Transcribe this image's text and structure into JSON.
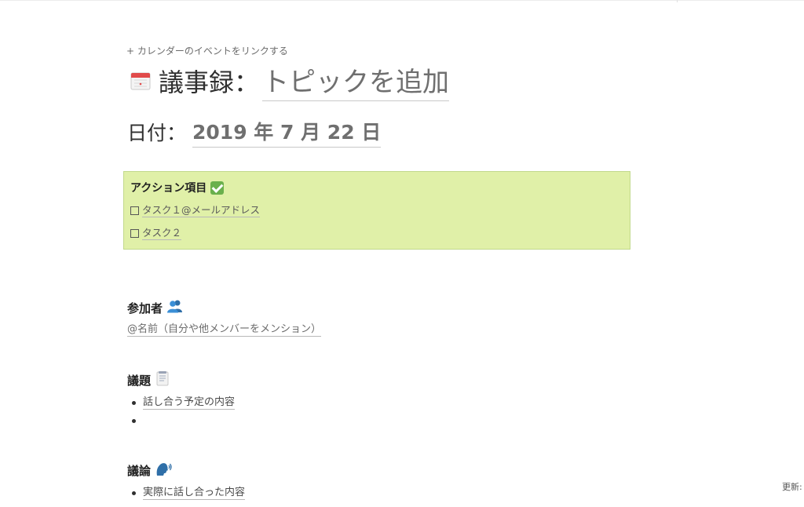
{
  "calendar_link": "+ カレンダーのイベントをリンクする",
  "title": {
    "icon": "calendar-icon",
    "label": "議事録：",
    "topic": "トピックを追加"
  },
  "date": {
    "label": "日付：",
    "value": "2019 年 7 月 22 日"
  },
  "callout": {
    "background": "#e0f0a8",
    "title": "アクション項目",
    "icon": "check-mark-button-icon",
    "todos": [
      {
        "label": "タスク１@メールアドレス",
        "checked": false
      },
      {
        "label": "タスク２",
        "checked": false
      }
    ]
  },
  "participants": {
    "heading": "参加者",
    "icon": "busts-in-silhouette-icon",
    "text": "@名前（自分や他メンバーをメンション）"
  },
  "agenda": {
    "heading": "議題",
    "icon": "memo-icon",
    "items": [
      "話し合う予定の内容",
      ""
    ]
  },
  "discussion": {
    "heading": "議論",
    "icon": "speaking-head-icon",
    "items": [
      "実際に話し合った内容"
    ]
  },
  "footer": {
    "updated_label": "更新:"
  }
}
